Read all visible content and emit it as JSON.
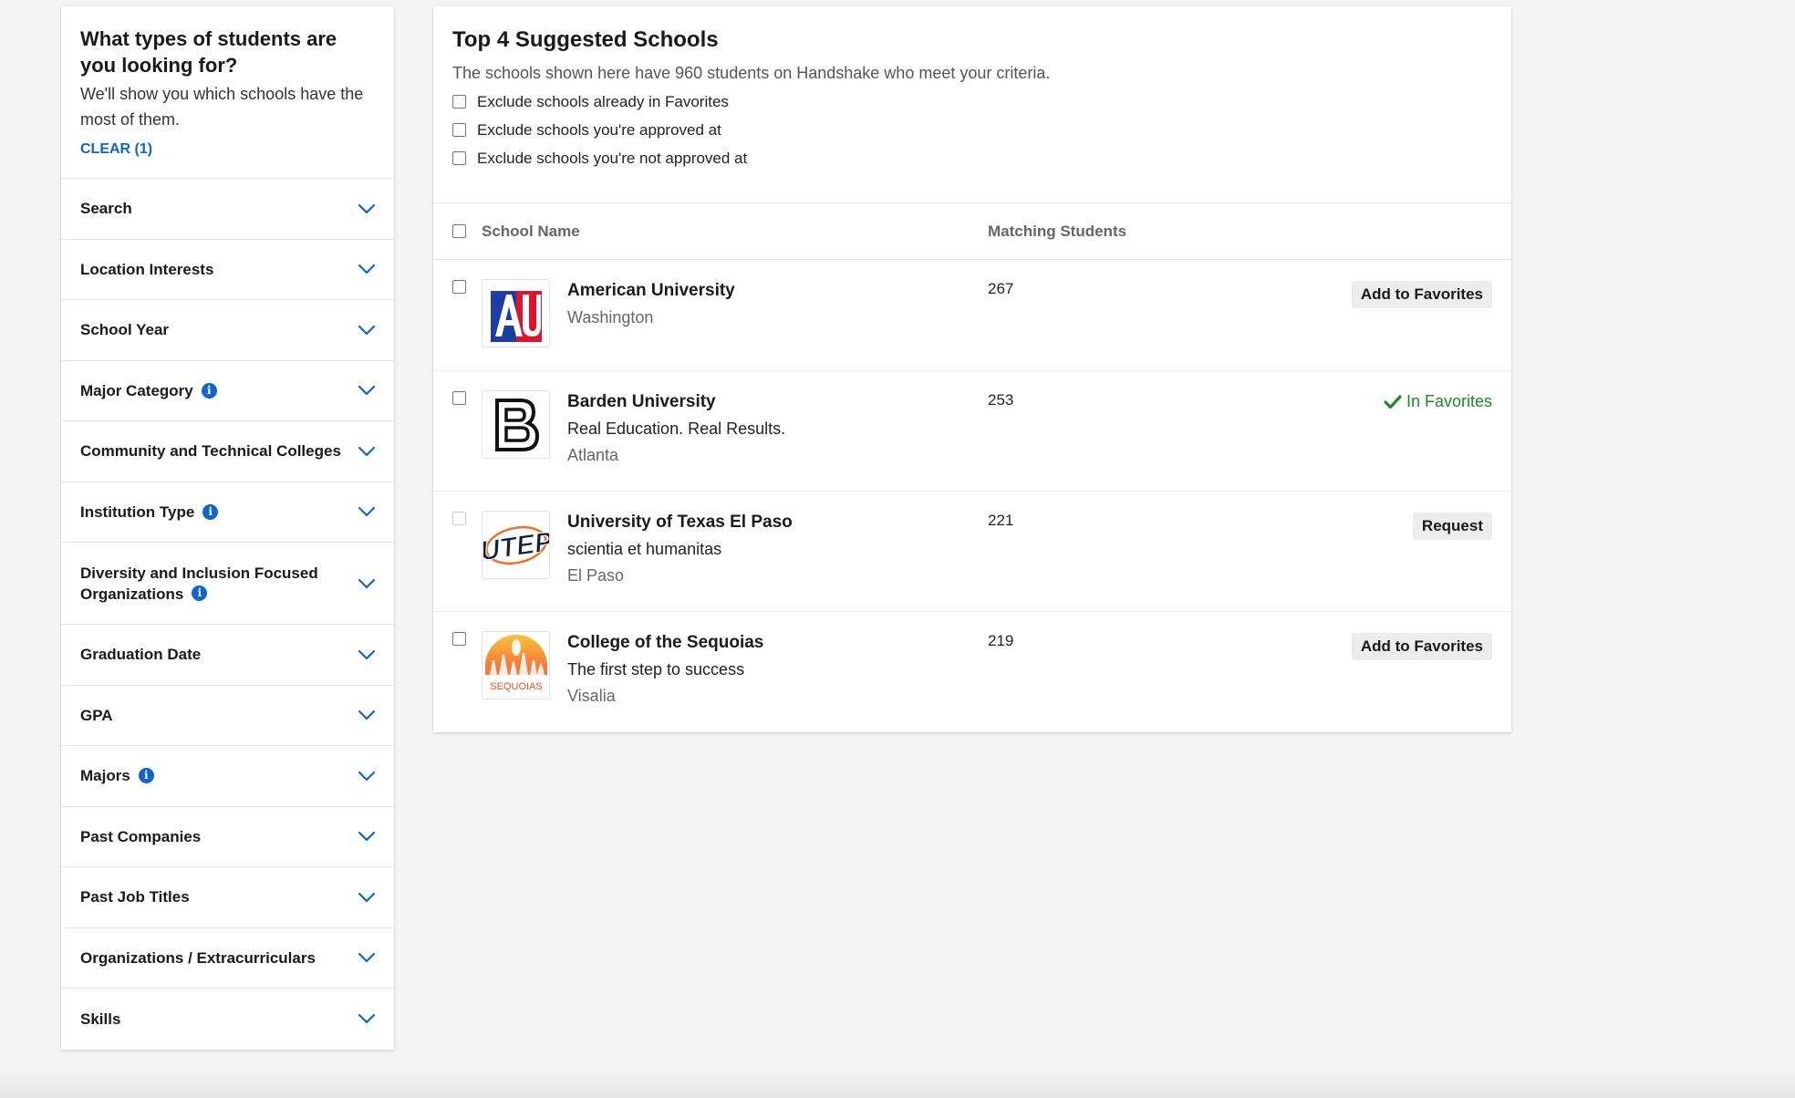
{
  "sidebar": {
    "title": "What types of students are you looking for?",
    "description": "We'll show you which schools have the most of them.",
    "clear_label": "CLEAR (1)",
    "filters": [
      {
        "label": "Search",
        "info": false
      },
      {
        "label": "Location Interests",
        "info": false
      },
      {
        "label": "School Year",
        "info": false
      },
      {
        "label": "Major Category",
        "info": true
      },
      {
        "label": "Community and Technical Colleges",
        "info": false
      },
      {
        "label": "Institution Type",
        "info": true
      },
      {
        "label": "Diversity and Inclusion Focused Organizations",
        "info": true
      },
      {
        "label": "Graduation Date",
        "info": false
      },
      {
        "label": "GPA",
        "info": false
      },
      {
        "label": "Majors",
        "info": true
      },
      {
        "label": "Past Companies",
        "info": false
      },
      {
        "label": "Past Job Titles",
        "info": false
      },
      {
        "label": "Organizations / Extracurriculars",
        "info": false
      },
      {
        "label": "Skills",
        "info": false
      }
    ]
  },
  "main": {
    "title": "Top 4 Suggested Schools",
    "subtitle": "The schools shown here have 960 students on Handshake who meet your criteria.",
    "exclusions": [
      "Exclude schools already in Favorites",
      "Exclude schools you're approved at",
      "Exclude schools you're not approved at"
    ],
    "table_headers": {
      "school_name": "School Name",
      "matching_students": "Matching Students"
    },
    "schools": [
      {
        "name": "American University",
        "tagline": "",
        "city": "Washington",
        "count": "267",
        "action": "Add to Favorites",
        "action_type": "button",
        "logo_icon": "american-university-logo"
      },
      {
        "name": "Barden University",
        "tagline": "Real Education. Real Results.",
        "city": "Atlanta",
        "count": "253",
        "action": "In Favorites",
        "action_type": "status",
        "logo_icon": "barden-university-logo"
      },
      {
        "name": "University of Texas El Paso",
        "tagline": "scientia et humanitas",
        "city": "El Paso",
        "count": "221",
        "action": "Request",
        "action_type": "button",
        "logo_icon": "utep-logo"
      },
      {
        "name": "College of the Sequoias",
        "tagline": "The first step to success",
        "city": "Visalia",
        "count": "219",
        "action": "Add to Favorites",
        "action_type": "button",
        "logo_icon": "college-of-the-sequoias-logo"
      }
    ],
    "logo_texts": {
      "utep": "UTEP",
      "sequoias": "SEQUOIAS"
    }
  },
  "colors": {
    "accent_blue": "#1064cf",
    "favorite_green": "#1b8a2d"
  }
}
